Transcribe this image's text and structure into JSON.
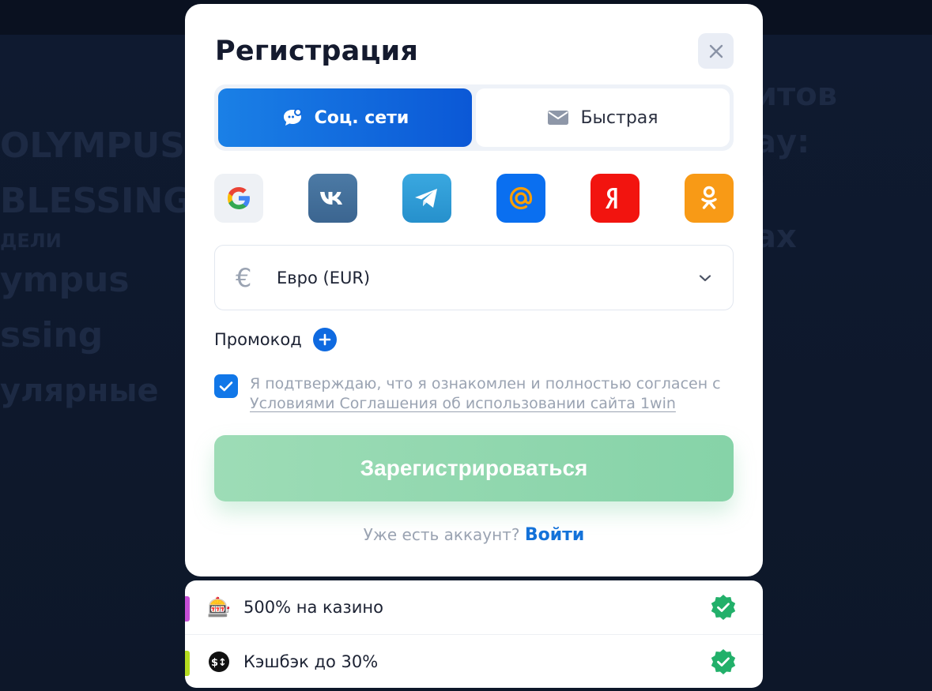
{
  "background": {
    "left_lines": [
      "OLYMPUS",
      "BLESSING",
      "ДЕЛИ",
      "ympus",
      "ssing",
      "",
      "улярные"
    ],
    "right_lines": [
      "итов",
      "ау:",
      "i",
      "ах"
    ]
  },
  "modal": {
    "title": "Регистрация",
    "close_icon": "close-icon",
    "tabs": [
      {
        "label": "Соц. сети",
        "icon": "chat-bubble-icon",
        "active": true
      },
      {
        "label": "Быстрая",
        "icon": "envelope-icon",
        "active": false
      }
    ],
    "socials": [
      {
        "name": "google",
        "glyph": "G"
      },
      {
        "name": "vk",
        "glyph": "vk"
      },
      {
        "name": "telegram",
        "glyph": "✈"
      },
      {
        "name": "mail-ru",
        "glyph": "@"
      },
      {
        "name": "yandex",
        "glyph": "Я"
      },
      {
        "name": "odnoklassniki",
        "glyph": "ok"
      }
    ],
    "currency": {
      "symbol": "€",
      "label": "Евро (EUR)"
    },
    "promo_label": "Промокод",
    "agreement": {
      "checked": true,
      "text": "Я подтверждаю, что я ознакомлен и полностью согласен с ",
      "link": "Условиями Соглашения об использовании сайта 1win"
    },
    "submit_label": "Зарегистрироваться",
    "login_question": "Уже есть аккаунт? ",
    "login_link": "Войти"
  },
  "bonuses": [
    {
      "emoji": "🎰",
      "label": "500% на казино",
      "bar_color": "#c64fd6"
    },
    {
      "emoji": "💱",
      "label": "Кэшбэк до 30%",
      "bar_color": "#b5dc1f"
    }
  ],
  "colors": {
    "accent_blue": "#0b58d6",
    "submit_green": "#86d3a8",
    "check_green": "#22b06a"
  }
}
